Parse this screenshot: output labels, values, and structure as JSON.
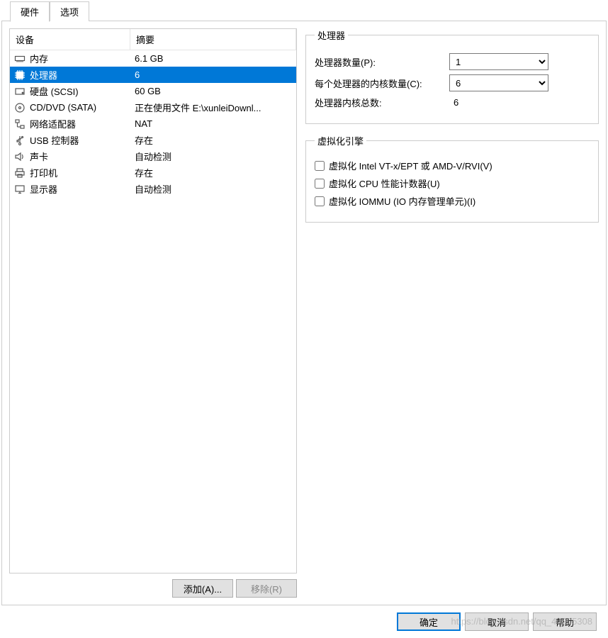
{
  "tabs": {
    "hardware": "硬件",
    "options": "选项"
  },
  "list": {
    "header_device": "设备",
    "header_summary": "摘要",
    "rows": [
      {
        "name": "内存",
        "summary": "6.1 GB"
      },
      {
        "name": "处理器",
        "summary": "6"
      },
      {
        "name": "硬盘 (SCSI)",
        "summary": "60 GB"
      },
      {
        "name": "CD/DVD (SATA)",
        "summary": "正在使用文件 E:\\xunleiDownl..."
      },
      {
        "name": "网络适配器",
        "summary": "NAT"
      },
      {
        "name": "USB 控制器",
        "summary": "存在"
      },
      {
        "name": "声卡",
        "summary": "自动检测"
      },
      {
        "name": "打印机",
        "summary": "存在"
      },
      {
        "name": "显示器",
        "summary": "自动检测"
      }
    ]
  },
  "buttons": {
    "add": "添加(A)...",
    "remove": "移除(R)",
    "ok": "确定",
    "cancel": "取消",
    "help": "帮助"
  },
  "processors": {
    "group_label": "处理器",
    "count_label": "处理器数量(P):",
    "count_value": "1",
    "cores_label": "每个处理器的内核数量(C):",
    "cores_value": "6",
    "total_label": "处理器内核总数:",
    "total_value": "6"
  },
  "virtualization": {
    "group_label": "虚拟化引擎",
    "vt": "虚拟化 Intel VT-x/EPT 或 AMD-V/RVI(V)",
    "cpu": "虚拟化 CPU 性能计数器(U)",
    "iommu": "虚拟化 IOMMU (IO 内存管理单元)(I)"
  },
  "watermark": "https://blog.csdn.net/qq_44905308"
}
